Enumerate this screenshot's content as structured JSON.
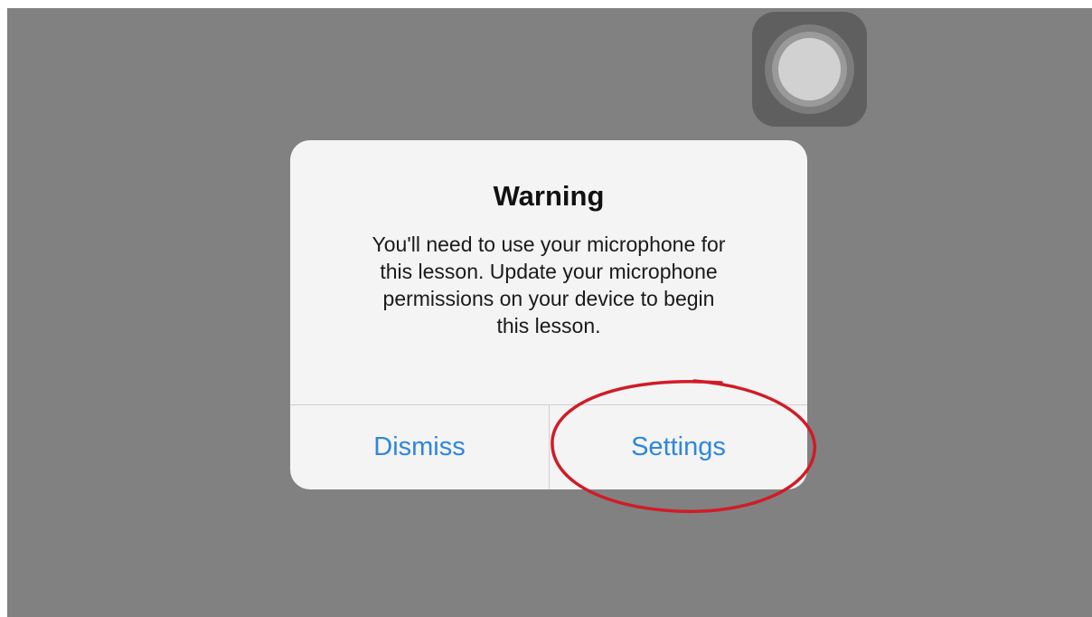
{
  "alert": {
    "title": "Warning",
    "message_lines": [
      "You'll need to use your microphone for",
      "this lesson. Update your microphone",
      "permissions on your device to begin",
      "this lesson."
    ],
    "buttons": {
      "dismiss": "Dismiss",
      "settings": "Settings"
    }
  },
  "colors": {
    "background": "#818182",
    "alert_background": "#f4f4f4",
    "button_text": "#2f86dd",
    "annotation": "#d01c26"
  },
  "icons": {
    "assistive_touch": "assistive-touch-icon"
  }
}
